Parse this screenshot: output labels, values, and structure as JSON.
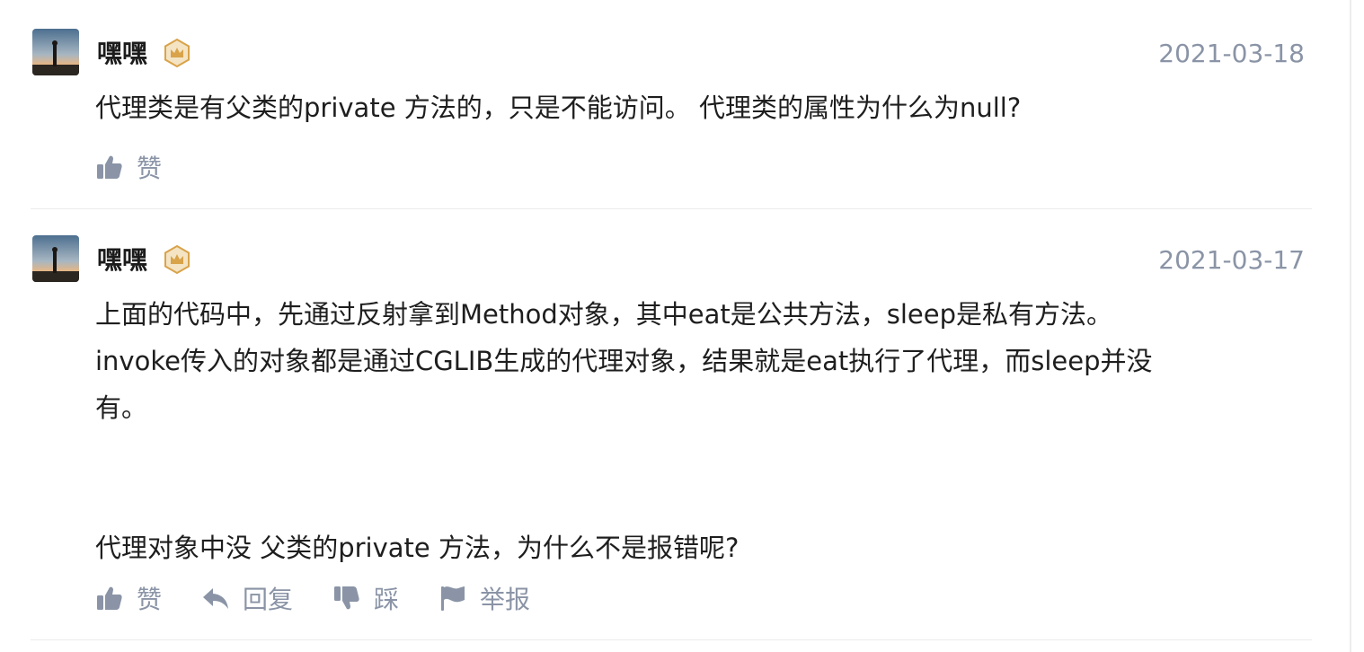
{
  "comments": [
    {
      "username": "嘿嘿",
      "date": "2021-03-18",
      "content": "代理类是有父类的private 方法的，只是不能访问。 代理类的属性为什么为null?",
      "actions": {
        "like": "赞"
      }
    },
    {
      "username": "嘿嘿",
      "date": "2021-03-17",
      "content": "上面的代码中，先通过反射拿到Method对象，其中eat是公共方法，sleep是私有方法。\ninvoke传入的对象都是通过CGLIB生成的代理对象，结果就是eat执行了代理，而sleep并没\n有。\n\n\n代理对象中没 父类的private 方法，为什么不是报错呢?",
      "actions": {
        "like": "赞",
        "reply": "回复",
        "dislike": "踩",
        "report": "举报"
      }
    }
  ],
  "colors": {
    "meta_gray": "#8a94a6",
    "text": "#1e1e1e",
    "badge_gold": "#d9a34a",
    "divider": "#ececec"
  },
  "icons": [
    "thumbs-up-icon",
    "reply-arrow-icon",
    "thumbs-down-icon",
    "flag-icon",
    "crown-badge-icon"
  ]
}
